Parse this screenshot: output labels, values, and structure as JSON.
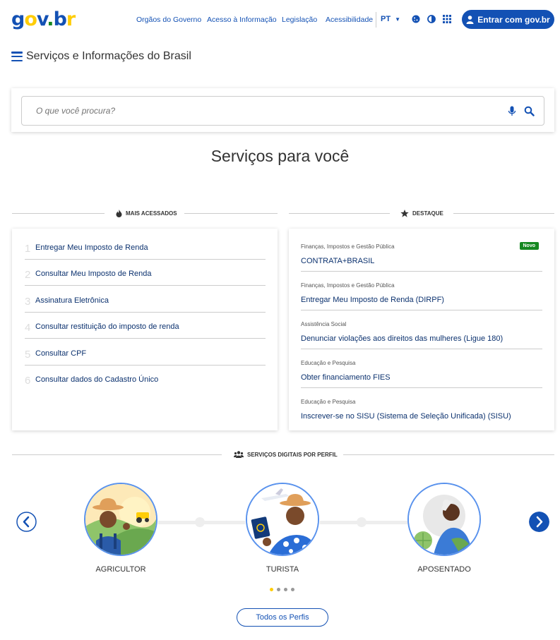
{
  "header": {
    "logo_text": "gov.br",
    "nav": [
      "Orgãos do Governo",
      "Acesso à Informação",
      "Legislação",
      "Acessibilidade"
    ],
    "language": "PT",
    "login_label": "Entrar com gov.br"
  },
  "site_title": "Serviços e Informações do Brasil",
  "search": {
    "placeholder": "O que você procura?"
  },
  "page_heading": "Serviços para você",
  "mais_acessados": {
    "title": "MAIS ACESSADOS",
    "items": [
      {
        "num": "1",
        "label": "Entregar Meu Imposto de Renda"
      },
      {
        "num": "2",
        "label": "Consultar Meu Imposto de Renda"
      },
      {
        "num": "3",
        "label": "Assinatura Eletrônica"
      },
      {
        "num": "4",
        "label": "Consultar restituição do imposto de renda"
      },
      {
        "num": "5",
        "label": "Consultar CPF"
      },
      {
        "num": "6",
        "label": "Consultar dados do Cadastro Único"
      }
    ]
  },
  "destaque": {
    "title": "DESTAQUE",
    "items": [
      {
        "category": "Finanças, Impostos e Gestão Pública",
        "label": "CONTRATA+BRASIL",
        "badge": "Novo"
      },
      {
        "category": "Finanças, Impostos e Gestão Pública",
        "label": "Entregar Meu Imposto de Renda (DIRPF)"
      },
      {
        "category": "Assistência Social",
        "label": "Denunciar violações aos direitos das mulheres (Ligue 180)"
      },
      {
        "category": "Educação e Pesquisa",
        "label": "Obter financiamento FIES"
      },
      {
        "category": "Educação e Pesquisa",
        "label": "Inscrever-se no SISU (Sistema de Seleção Unificada) (SISU)"
      }
    ]
  },
  "perfis": {
    "title": "SERVIÇOS DIGITAIS POR PERFIL",
    "items": [
      "AGRICULTOR",
      "TURISTA",
      "APOSENTADO"
    ],
    "all_label": "Todos os Perfis",
    "active_page": 1,
    "page_count": 4
  },
  "colors": {
    "primary": "#1351b4",
    "dark_blue": "#0c326f",
    "yellow": "#ffcd07",
    "green": "#168821"
  },
  "icons": [
    "menu-icon",
    "user-icon",
    "cookie-icon",
    "contrast-icon",
    "apps-grid-icon",
    "chevron-down-icon",
    "microphone-icon",
    "search-icon",
    "fire-icon",
    "star-icon",
    "people-icon",
    "chevron-left-icon",
    "chevron-right-icon"
  ]
}
